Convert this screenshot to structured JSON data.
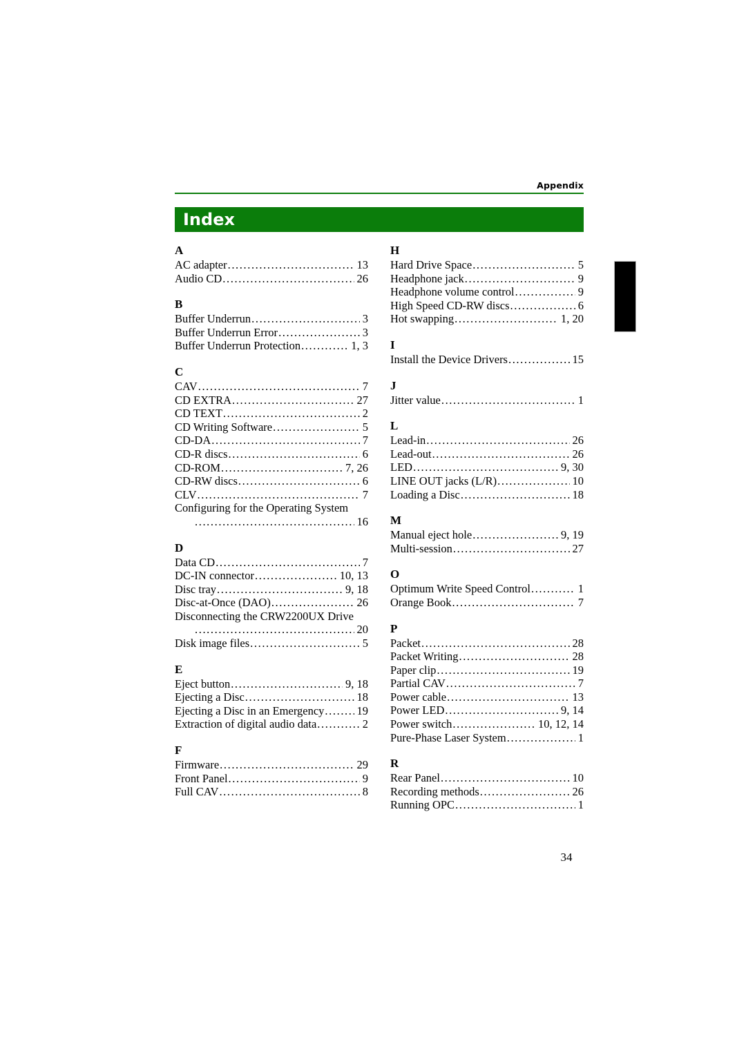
{
  "header": {
    "running_label": "Appendix",
    "rule_color": "#0b7d0b"
  },
  "title_bar": {
    "title": "Index",
    "background_color": "#0b7d0b",
    "text_color": "#ffffff"
  },
  "thumb_tab": {
    "color": "#000000"
  },
  "folio": {
    "page_number": "34"
  },
  "index": {
    "left_column": [
      {
        "letter": "A",
        "entries": [
          {
            "term": "AC adapter",
            "pages": "13",
            "wrapped": false
          },
          {
            "term": "Audio CD",
            "pages": "26",
            "wrapped": false
          }
        ]
      },
      {
        "letter": "B",
        "entries": [
          {
            "term": "Buffer Underrun",
            "pages": "3",
            "wrapped": false
          },
          {
            "term": "Buffer Underrun Error",
            "pages": "3",
            "wrapped": false
          },
          {
            "term": "Buffer Underrun Protection",
            "pages": "1, 3",
            "wrapped": false
          }
        ]
      },
      {
        "letter": "C",
        "entries": [
          {
            "term": "CAV",
            "pages": "7",
            "wrapped": false
          },
          {
            "term": "CD EXTRA",
            "pages": "27",
            "wrapped": false
          },
          {
            "term": "CD TEXT",
            "pages": "2",
            "wrapped": false
          },
          {
            "term": "CD Writing Software",
            "pages": "5",
            "wrapped": false
          },
          {
            "term": "CD-DA",
            "pages": "7",
            "wrapped": false
          },
          {
            "term": "CD-R discs",
            "pages": "6",
            "wrapped": false
          },
          {
            "term": "CD-ROM",
            "pages": "7, 26",
            "wrapped": false
          },
          {
            "term": "CD-RW discs",
            "pages": "6",
            "wrapped": false
          },
          {
            "term": "CLV",
            "pages": "7",
            "wrapped": false
          },
          {
            "term": "Configuring for the Operating System",
            "pages": "16",
            "wrapped": true
          }
        ]
      },
      {
        "letter": "D",
        "entries": [
          {
            "term": "Data CD",
            "pages": "7",
            "wrapped": false
          },
          {
            "term": "DC-IN connector",
            "pages": "10, 13",
            "wrapped": false
          },
          {
            "term": "Disc tray",
            "pages": "9, 18",
            "wrapped": false
          },
          {
            "term": "Disc-at-Once (DAO)",
            "pages": "26",
            "wrapped": false
          },
          {
            "term": "Disconnecting the CRW2200UX Drive",
            "pages": "20",
            "wrapped": true
          },
          {
            "term": "Disk image files",
            "pages": "5",
            "wrapped": false
          }
        ]
      },
      {
        "letter": "E",
        "entries": [
          {
            "term": "Eject button",
            "pages": "9, 18",
            "wrapped": false
          },
          {
            "term": "Ejecting a Disc",
            "pages": "18",
            "wrapped": false
          },
          {
            "term": "Ejecting a Disc in an Emergency",
            "pages": "19",
            "wrapped": false
          },
          {
            "term": "Extraction of digital audio data",
            "pages": "2",
            "wrapped": false
          }
        ]
      },
      {
        "letter": "F",
        "entries": [
          {
            "term": "Firmware",
            "pages": "29",
            "wrapped": false
          },
          {
            "term": "Front Panel",
            "pages": "9",
            "wrapped": false
          },
          {
            "term": "Full CAV",
            "pages": "8",
            "wrapped": false
          }
        ]
      }
    ],
    "right_column": [
      {
        "letter": "H",
        "entries": [
          {
            "term": "Hard Drive Space",
            "pages": "5",
            "wrapped": false
          },
          {
            "term": "Headphone jack",
            "pages": "9",
            "wrapped": false
          },
          {
            "term": "Headphone volume control",
            "pages": "9",
            "wrapped": false
          },
          {
            "term": "High Speed CD-RW discs",
            "pages": "6",
            "wrapped": false
          },
          {
            "term": "Hot swapping",
            "pages": "1, 20",
            "wrapped": false
          }
        ]
      },
      {
        "letter": "I",
        "entries": [
          {
            "term": "Install the Device Drivers",
            "pages": "15",
            "wrapped": false
          }
        ]
      },
      {
        "letter": "J",
        "entries": [
          {
            "term": "Jitter value",
            "pages": "1",
            "wrapped": false
          }
        ]
      },
      {
        "letter": "L",
        "entries": [
          {
            "term": "Lead-in",
            "pages": "26",
            "wrapped": false
          },
          {
            "term": "Lead-out",
            "pages": "26",
            "wrapped": false
          },
          {
            "term": "LED",
            "pages": "9, 30",
            "wrapped": false
          },
          {
            "term": "LINE OUT jacks (L/R)",
            "pages": "10",
            "wrapped": false
          },
          {
            "term": "Loading a Disc",
            "pages": "18",
            "wrapped": false
          }
        ]
      },
      {
        "letter": "M",
        "entries": [
          {
            "term": "Manual eject hole",
            "pages": "9, 19",
            "wrapped": false
          },
          {
            "term": "Multi-session",
            "pages": "27",
            "wrapped": false
          }
        ]
      },
      {
        "letter": "O",
        "entries": [
          {
            "term": "Optimum Write Speed Control",
            "pages": "1",
            "wrapped": false
          },
          {
            "term": "Orange Book",
            "pages": "7",
            "wrapped": false
          }
        ]
      },
      {
        "letter": "P",
        "entries": [
          {
            "term": "Packet",
            "pages": "28",
            "wrapped": false
          },
          {
            "term": "Packet Writing",
            "pages": "28",
            "wrapped": false
          },
          {
            "term": "Paper clip",
            "pages": "19",
            "wrapped": false
          },
          {
            "term": "Partial CAV",
            "pages": "7",
            "wrapped": false
          },
          {
            "term": "Power cable",
            "pages": "13",
            "wrapped": false
          },
          {
            "term": "Power LED",
            "pages": "9, 14",
            "wrapped": false
          },
          {
            "term": "Power switch",
            "pages": "10, 12, 14",
            "wrapped": false
          },
          {
            "term": "Pure-Phase Laser System",
            "pages": "1",
            "wrapped": false
          }
        ]
      },
      {
        "letter": "R",
        "entries": [
          {
            "term": "Rear Panel",
            "pages": "10",
            "wrapped": false
          },
          {
            "term": "Recording methods",
            "pages": "26",
            "wrapped": false
          },
          {
            "term": "Running OPC",
            "pages": "1",
            "wrapped": false
          }
        ]
      }
    ]
  }
}
